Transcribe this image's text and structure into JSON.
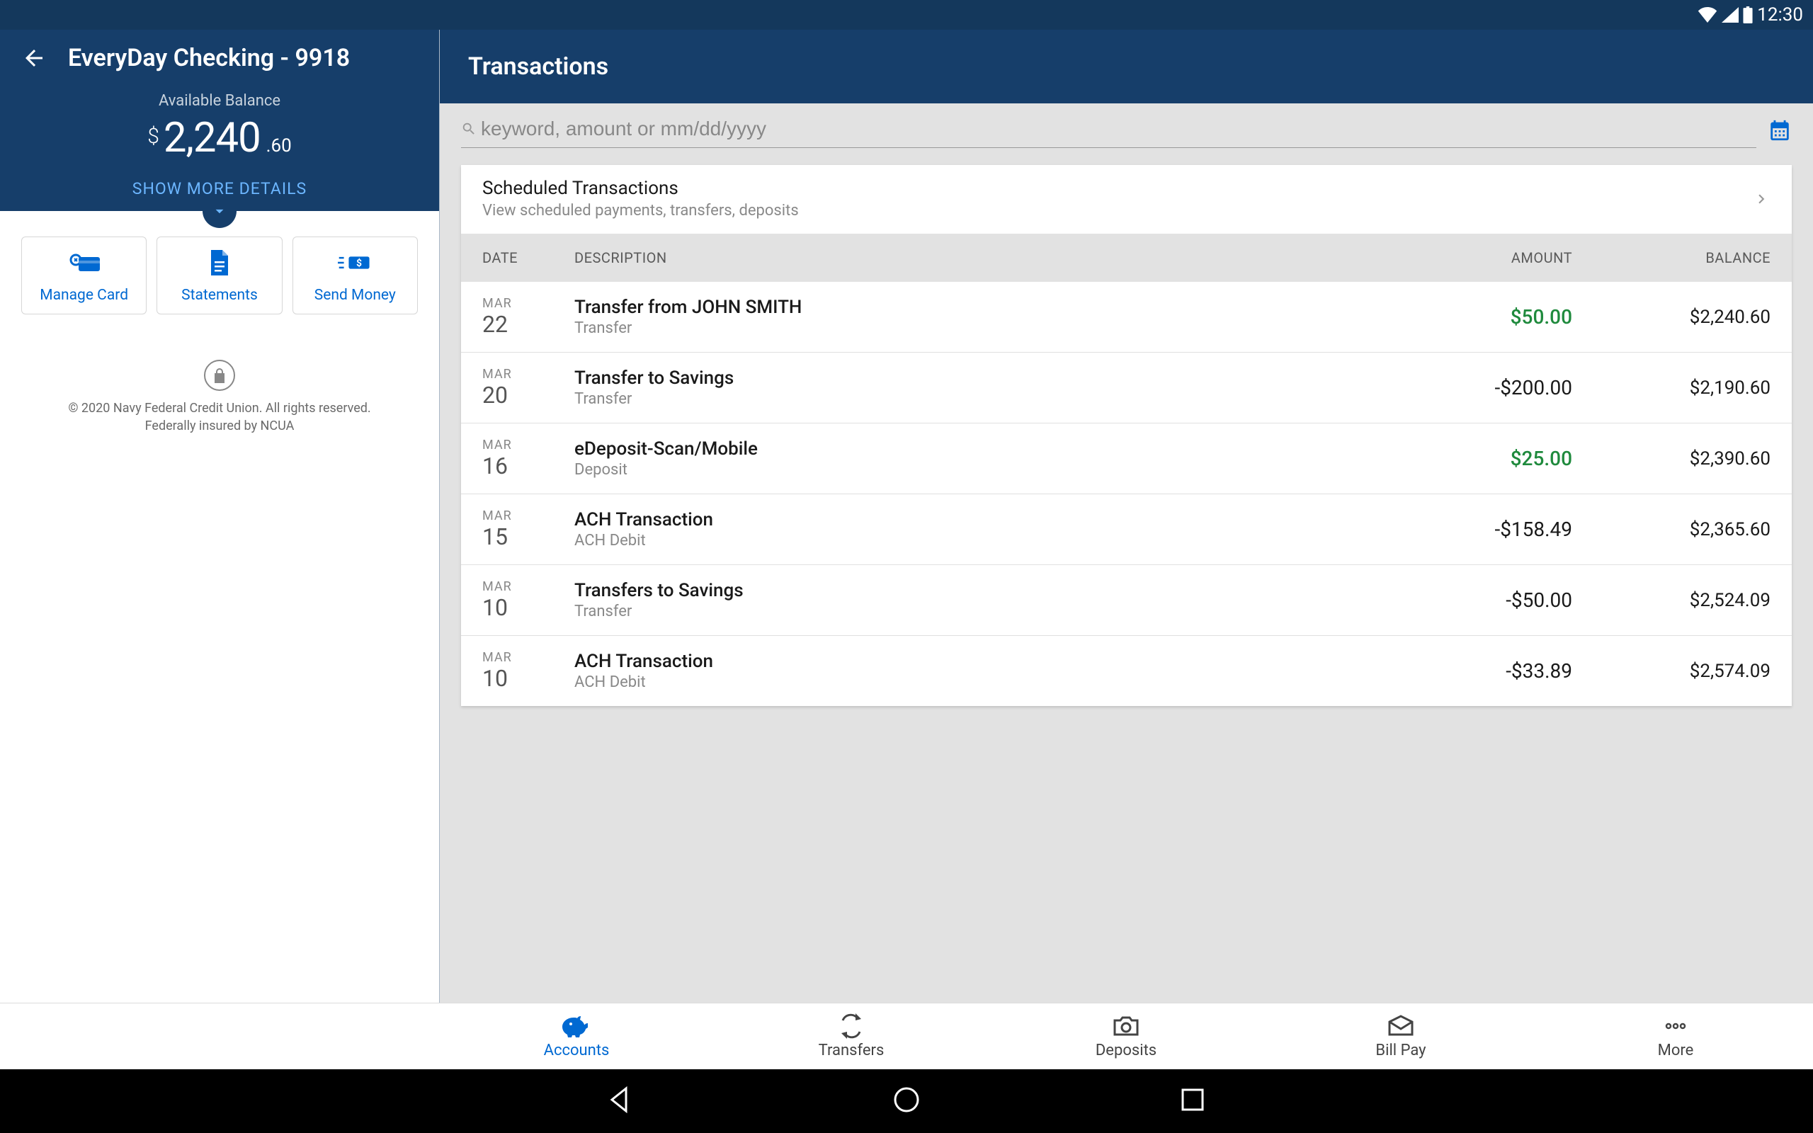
{
  "status": {
    "time": "12:30"
  },
  "sidebar": {
    "account_title": "EveryDay Checking - 9918",
    "balance_label": "Available Balance",
    "balance_currency": "$",
    "balance_whole": "2,240",
    "balance_cents": ".60",
    "show_more": "SHOW MORE DETAILS",
    "actions": [
      {
        "label": "Manage Card"
      },
      {
        "label": "Statements"
      },
      {
        "label": "Send Money"
      }
    ],
    "footer_line1": "© 2020 Navy Federal Credit Union. All rights reserved.",
    "footer_line2": "Federally insured by NCUA"
  },
  "main": {
    "title": "Transactions",
    "search_placeholder": "keyword, amount or mm/dd/yyyy",
    "scheduled": {
      "title": "Scheduled Transactions",
      "subtitle": "View scheduled payments, transfers, deposits"
    },
    "columns": {
      "date": "DATE",
      "description": "DESCRIPTION",
      "amount": "AMOUNT",
      "balance": "BALANCE"
    },
    "transactions": [
      {
        "month": "MAR",
        "day": "22",
        "title": "Transfer from JOHN SMITH",
        "sub": "Transfer",
        "amount": "$50.00",
        "positive": true,
        "balance": "$2,240.60"
      },
      {
        "month": "MAR",
        "day": "20",
        "title": "Transfer to Savings",
        "sub": "Transfer",
        "amount": "-$200.00",
        "positive": false,
        "balance": "$2,190.60"
      },
      {
        "month": "MAR",
        "day": "16",
        "title": "eDeposit-Scan/Mobile",
        "sub": "Deposit",
        "amount": "$25.00",
        "positive": true,
        "balance": "$2,390.60"
      },
      {
        "month": "MAR",
        "day": "15",
        "title": "ACH Transaction",
        "sub": "ACH Debit",
        "amount": "-$158.49",
        "positive": false,
        "balance": "$2,365.60"
      },
      {
        "month": "MAR",
        "day": "10",
        "title": "Transfers to Savings",
        "sub": "Transfer",
        "amount": "-$50.00",
        "positive": false,
        "balance": "$2,524.09"
      },
      {
        "month": "MAR",
        "day": "10",
        "title": "ACH Transaction",
        "sub": "ACH Debit",
        "amount": "-$33.89",
        "positive": false,
        "balance": "$2,574.09"
      }
    ]
  },
  "nav": {
    "items": [
      {
        "label": "Accounts"
      },
      {
        "label": "Transfers"
      },
      {
        "label": "Deposits"
      },
      {
        "label": "Bill Pay"
      },
      {
        "label": "More"
      }
    ]
  }
}
